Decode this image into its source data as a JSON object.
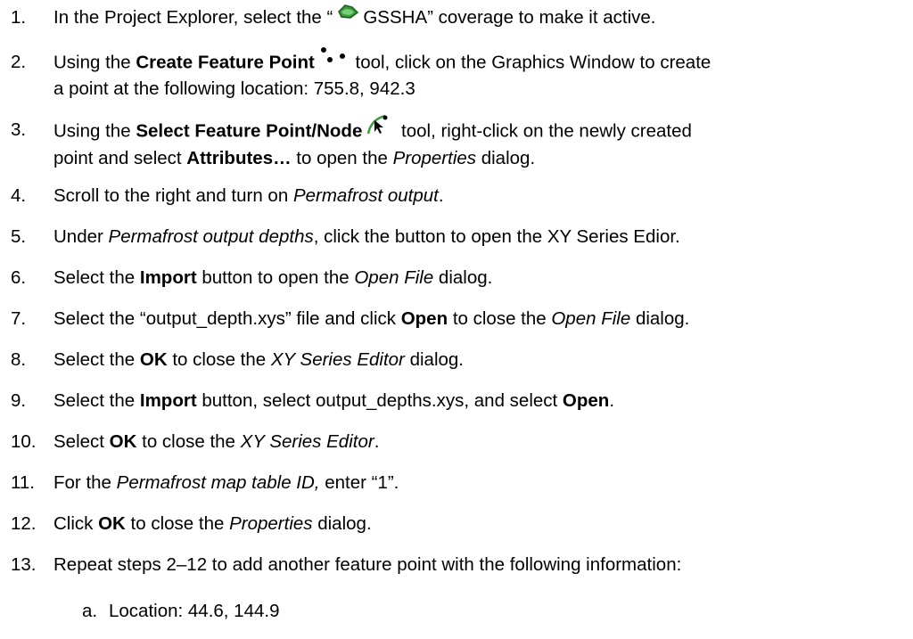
{
  "steps": [
    {
      "num": "1.",
      "pre": "In the Project Explorer, select the “",
      "post": "GSSHA” coverage to make it active."
    },
    {
      "num": "2.",
      "pre": "Using the ",
      "bold": "Create Feature Point",
      "post": " tool, click on the Graphics Window to create",
      "line2": "a point at the following location: 755.8, 942.3"
    },
    {
      "num": "3.",
      "pre": "Using the ",
      "bold": "Select Feature Point/Node",
      "post": " tool, right-click on the newly created",
      "line2_pre": "point and select ",
      "line2_bold": "Attributes…",
      "line2_mid": " to open the ",
      "line2_italic": "Properties",
      "line2_post": " dialog."
    },
    {
      "num": "4.",
      "pre": "Scroll to the right and turn on ",
      "italic": "Permafrost output",
      "post": "."
    },
    {
      "num": "5.",
      "pre": "Under ",
      "italic": "Permafrost output depths",
      "post": ", click the button to open the XY Series Edior."
    },
    {
      "num": "6.",
      "pre": "Select the ",
      "bold": "Import",
      "mid": " button to open the ",
      "italic": "Open File",
      "post": " dialog."
    },
    {
      "num": "7.",
      "pre": "Select the “output_depth.xys” file and click ",
      "bold": "Open",
      "mid": " to close the ",
      "italic": "Open File",
      "post": " dialog."
    },
    {
      "num": "8.",
      "pre": "Select the ",
      "bold": "OK",
      "mid": " to close the ",
      "italic": "XY Series Editor",
      "post": " dialog."
    },
    {
      "num": "9.",
      "pre": "Select the ",
      "bold": "Import",
      "mid": " button, select output_depths.xys, and select ",
      "bold2": "Open",
      "post": "."
    },
    {
      "num": "10.",
      "pre": "Select ",
      "bold": "OK",
      "mid": " to close the ",
      "italic": "XY Series Editor",
      "post": "."
    },
    {
      "num": "11.",
      "pre": "For the ",
      "italic": "Permafrost map table ID,",
      "post": " enter “1”."
    },
    {
      "num": "12.",
      "pre": "Click ",
      "bold": "OK",
      "mid": " to close the ",
      "italic": "Properties",
      "post": " dialog."
    },
    {
      "num": "13.",
      "pre": "Repeat steps 2–12 to add another feature point with the following information:"
    }
  ],
  "substep": {
    "num": "a.",
    "text": "Location: 44.6, 144.9"
  },
  "icons": [
    "gsSHA-coverage-icon",
    "create-feature-point-icon",
    "select-feature-point-icon"
  ]
}
